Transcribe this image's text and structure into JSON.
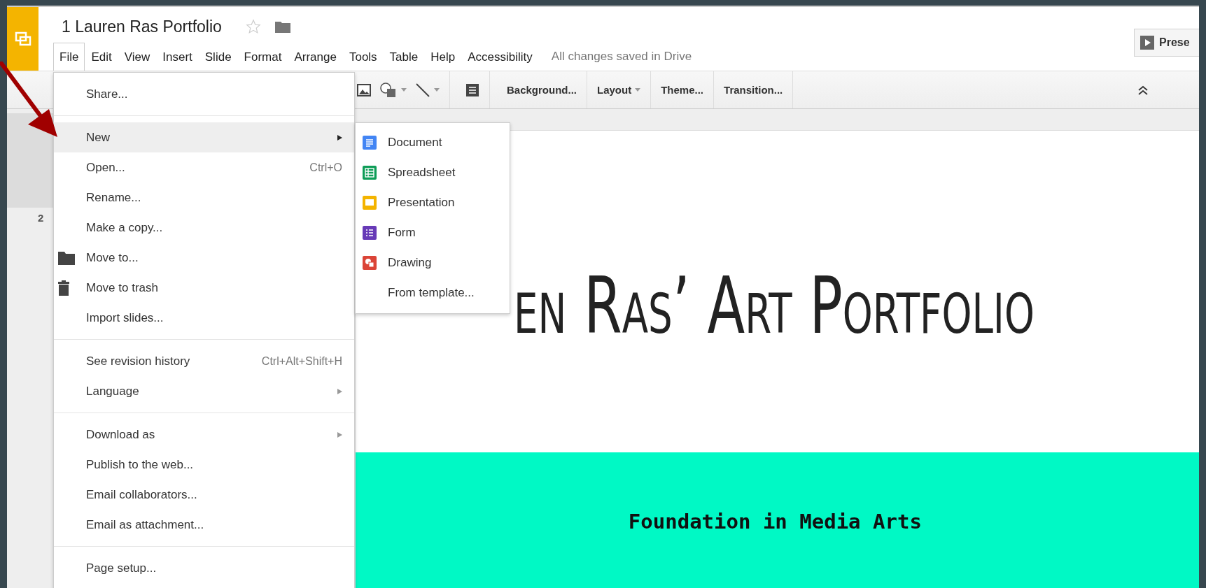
{
  "app": {
    "title": "1 Lauren Ras Portfolio",
    "starred": false
  },
  "menubar": [
    {
      "label": "File",
      "selected": true
    },
    {
      "label": "Edit",
      "selected": false
    },
    {
      "label": "View",
      "selected": false
    },
    {
      "label": "Insert",
      "selected": false
    },
    {
      "label": "Slide",
      "selected": false
    },
    {
      "label": "Format",
      "selected": false
    },
    {
      "label": "Arrange",
      "selected": false
    },
    {
      "label": "Tools",
      "selected": false
    },
    {
      "label": "Table",
      "selected": false
    },
    {
      "label": "Help",
      "selected": false
    },
    {
      "label": "Accessibility",
      "selected": false
    }
  ],
  "save_status": "All changes saved in Drive",
  "present_button": "Prese",
  "toolbar": [
    {
      "label": "Background...",
      "dropdown": false
    },
    {
      "label": "Layout",
      "dropdown": true
    },
    {
      "label": "Theme...",
      "dropdown": false
    },
    {
      "label": "Transition...",
      "dropdown": false
    }
  ],
  "filmstrip": [
    {
      "selected": true
    },
    {
      "number": "2",
      "selected": false
    }
  ],
  "file_menu": [
    [
      {
        "label": "Share...",
        "kind": "plain",
        "submenu": false,
        "selected": false
      }
    ],
    [
      {
        "label": "New",
        "kind": "plain",
        "submenu": true,
        "selected": true
      },
      {
        "label": "Open...",
        "kind": "plain",
        "shortcut": "Ctrl+O",
        "submenu": false,
        "selected": false
      },
      {
        "label": "Rename...",
        "kind": "plain",
        "submenu": false,
        "selected": false
      },
      {
        "label": "Make a copy...",
        "kind": "plain",
        "submenu": false,
        "selected": false
      },
      {
        "label": "Move to...",
        "kind": "folder",
        "submenu": false,
        "selected": false
      },
      {
        "label": "Move to trash",
        "kind": "trash",
        "submenu": false,
        "selected": false
      },
      {
        "label": "Import slides...",
        "kind": "plain",
        "submenu": false,
        "selected": false
      }
    ],
    [
      {
        "label": "See revision history",
        "kind": "plain",
        "shortcut": "Ctrl+Alt+Shift+H",
        "submenu": false,
        "selected": false
      },
      {
        "label": "Language",
        "kind": "plain",
        "submenu": true,
        "selected": false
      }
    ],
    [
      {
        "label": "Download as",
        "kind": "plain",
        "submenu": true,
        "selected": false
      },
      {
        "label": "Publish to the web...",
        "kind": "plain",
        "submenu": false,
        "selected": false
      },
      {
        "label": "Email collaborators...",
        "kind": "plain",
        "submenu": false,
        "selected": false
      },
      {
        "label": "Email as attachment...",
        "kind": "plain",
        "submenu": false,
        "selected": false
      }
    ],
    [
      {
        "label": "Page setup...",
        "kind": "plain",
        "submenu": false,
        "selected": false
      }
    ]
  ],
  "new_submenu": [
    {
      "label": "Document",
      "kind": "document",
      "color": "#4285f4"
    },
    {
      "label": "Spreadsheet",
      "kind": "spreadsheet",
      "color": "#0f9d58"
    },
    {
      "label": "Presentation",
      "kind": "presentation",
      "color": "#f4b400"
    },
    {
      "label": "Form",
      "kind": "form",
      "color": "#673ab7"
    },
    {
      "label": "Drawing",
      "kind": "drawing",
      "color": "#db4437"
    },
    {
      "label": "From template...",
      "kind": "plain"
    }
  ],
  "slide": {
    "title": "en Ras’ Art Portfolio",
    "subtitle": "Foundation in Media Arts"
  }
}
